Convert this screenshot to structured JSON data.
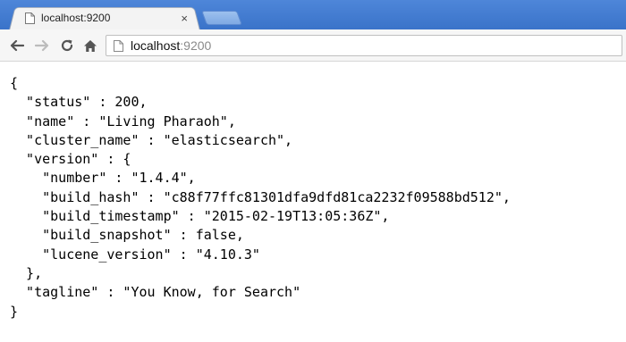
{
  "tab": {
    "title": "localhost:9200",
    "close_glyph": "×",
    "favicon_icon": "page-icon"
  },
  "toolbar": {
    "back_icon": "back-arrow-icon",
    "forward_icon": "forward-arrow-icon",
    "reload_icon": "reload-icon",
    "home_icon": "home-icon",
    "address": {
      "host": "localhost",
      "port": ":9200"
    }
  },
  "colors": {
    "tabstrip": "#3a73c9",
    "port_text": "#8a8a8a"
  },
  "json_lines": [
    "{",
    "  \"status\" : 200,",
    "  \"name\" : \"Living Pharaoh\",",
    "  \"cluster_name\" : \"elasticsearch\",",
    "  \"version\" : {",
    "    \"number\" : \"1.4.4\",",
    "    \"build_hash\" : \"c88f77ffc81301dfa9dfd81ca2232f09588bd512\",",
    "    \"build_timestamp\" : \"2015-02-19T13:05:36Z\",",
    "    \"build_snapshot\" : false,",
    "    \"lucene_version\" : \"4.10.3\"",
    "  },",
    "  \"tagline\" : \"You Know, for Search\"",
    "}"
  ]
}
